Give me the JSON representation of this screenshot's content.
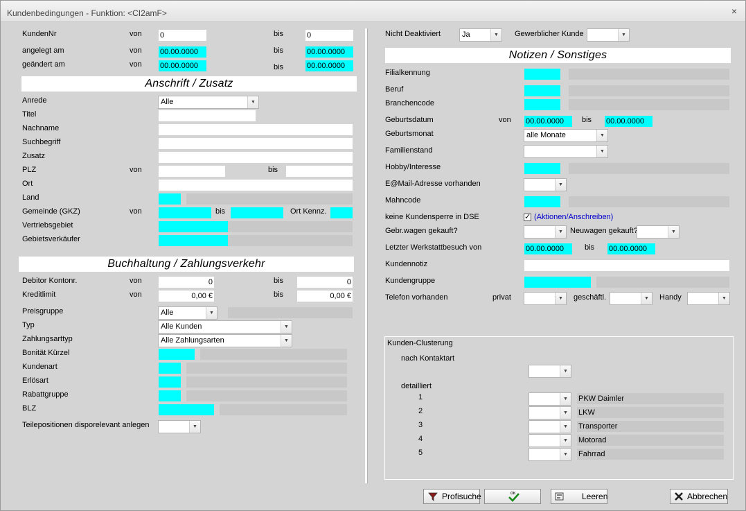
{
  "window": {
    "title": "Kundenbedingungen - Funktion: <CI2amF>",
    "close": "×"
  },
  "left": {
    "kundennr_label": "KundenNr",
    "von": "von",
    "bis": "bis",
    "kundennr_von": "0",
    "kundennr_bis": "0",
    "angelegt_label": "angelegt am",
    "angelegt_von": "00.00.0000",
    "angelegt_bis": "00.00.0000",
    "geaendert_label": "geändert am",
    "geaendert_von": "00.00.0000",
    "geaendert_bis": "00.00.0000",
    "section_anschrift": "Anschrift / Zusatz",
    "anrede_label": "Anrede",
    "anrede_value": "Alle",
    "titel_label": "Titel",
    "nachname_label": "Nachname",
    "suchbegriff_label": "Suchbegriff",
    "zusatz_label": "Zusatz",
    "plz_label": "PLZ",
    "ort_label": "Ort",
    "land_label": "Land",
    "gemeinde_label": "Gemeinde (GKZ)",
    "ort_kennz_label": "Ort Kennz.",
    "vertriebsgebiet_label": "Vertriebsgebiet",
    "gebietsverkaeufer_label": "Gebietsverkäufer",
    "section_buchhaltung": "Buchhaltung / Zahlungsverkehr",
    "debitor_label": "Debitor Kontonr.",
    "debitor_von": "0",
    "debitor_bis": "0",
    "kreditlimit_label": "Kreditlimit",
    "kreditlimit_von": "0,00 €",
    "kreditlimit_bis": "0,00 €",
    "preisgruppe_label": "Preisgruppe",
    "preisgruppe_value": "Alle",
    "typ_label": "Typ",
    "typ_value": "Alle Kunden",
    "zahlungsarttyp_label": "Zahlungsarttyp",
    "zahlungsarttyp_value": "Alle Zahlungsarten",
    "bonitaet_label": "Bonität Kürzel",
    "kundenart_label": "Kundenart",
    "erloesart_label": "Erlösart",
    "rabattgruppe_label": "Rabattgruppe",
    "blz_label": "BLZ",
    "teilepositionen_label": "Teilepositionen disporelevant anlegen"
  },
  "right": {
    "nicht_deaktiviert_label": "Nicht Deaktiviert",
    "nicht_deaktiviert_value": "Ja",
    "gewerblicher_kunde_label": "Gewerblicher Kunde",
    "section_notizen": "Notizen / Sonstiges",
    "filialkennung_label": "Filialkennung",
    "beruf_label": "Beruf",
    "branchencode_label": "Branchencode",
    "geburtsdatum_label": "Geburtsdatum",
    "von": "von",
    "bis": "bis",
    "geburtsdatum_von": "00.00.0000",
    "geburtsdatum_bis": "00.00.0000",
    "geburtsmonat_label": "Geburtsmonat",
    "geburtsmonat_value": "alle Monate",
    "familienstand_label": "Familienstand",
    "hobby_label": "Hobby/Interesse",
    "email_label": "E@Mail-Adresse vorhanden",
    "mahncode_label": "Mahncode",
    "kundensperre_label": "keine Kundensperre in DSE",
    "kundensperre_check": "✓",
    "aktionen_link": "(Aktionen/Anschreiben)",
    "gebrwagen_label": "Gebr.wagen gekauft?",
    "neuwagen_label": "Neuwagen gekauft?",
    "werkstatt_label": "Letzter Werkstattbesuch von",
    "werkstatt_von": "00.00.0000",
    "werkstatt_bis": "00.00.0000",
    "kundennotiz_label": "Kundennotiz",
    "kundengruppe_label": "Kundengruppe",
    "telefon_label": "Telefon vorhanden",
    "privat_label": "privat",
    "geschaeftl_label": "geschäftl.",
    "handy_label": "Handy"
  },
  "clustering": {
    "title": "Kunden-Clusterung",
    "kontaktart_label": "nach Kontaktart",
    "detailliert_label": "detailliert",
    "rows": [
      {
        "num": "1",
        "name": "PKW Daimler"
      },
      {
        "num": "2",
        "name": "LKW"
      },
      {
        "num": "3",
        "name": "Transporter"
      },
      {
        "num": "4",
        "name": "Motorad"
      },
      {
        "num": "5",
        "name": "Fahrrad"
      }
    ]
  },
  "buttons": {
    "profisuche": "Profisuche",
    "ok": "OK",
    "leeren": "Leeren",
    "abbrechen": "Abbrechen"
  },
  "colors": {
    "highlight": "#00ffff",
    "disabled": "#c8c8c8",
    "background": "#d4d4d4",
    "link": "#0000cc"
  }
}
